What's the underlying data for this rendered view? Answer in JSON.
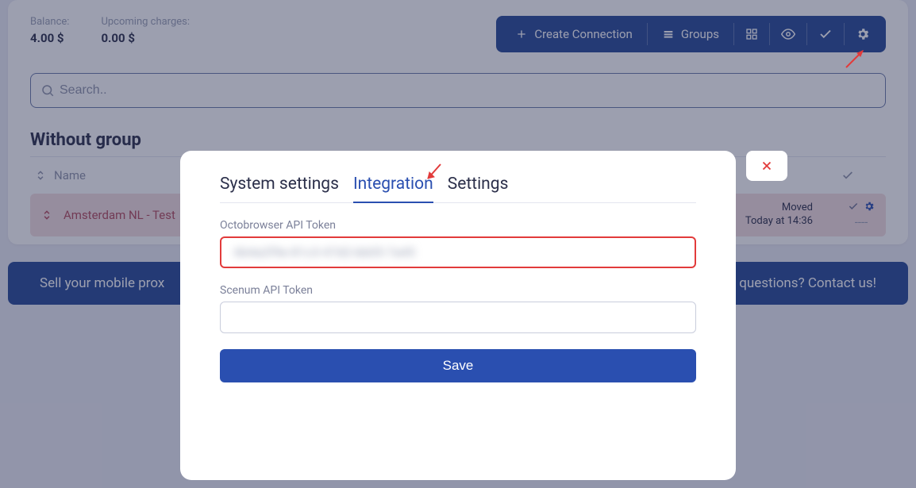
{
  "balances": {
    "balance_label": "Balance:",
    "balance_value": "4.00 $",
    "upcoming_label": "Upcoming charges:",
    "upcoming_value": "0.00 $"
  },
  "toolbar": {
    "create_label": "Create Connection",
    "groups_label": "Groups"
  },
  "search": {
    "placeholder": "Search.."
  },
  "group": {
    "title": "Without group",
    "name_header": "Name"
  },
  "row": {
    "name": "Amsterdam NL - Test",
    "status_line1": "Moved",
    "status_line2": "Today at 14:36",
    "empty": "----"
  },
  "banner": {
    "left": "Sell your mobile prox",
    "right": "Have questions? Contact us!"
  },
  "modal": {
    "tabs": {
      "system": "System settings",
      "integration": "Integration",
      "settings": "Settings"
    },
    "octo_label": "Octobrowser API Token",
    "octo_value": "6b4a2f9e-81c3-47d2-bb05-7a45",
    "scenum_label": "Scenum API Token",
    "scenum_value": "",
    "save": "Save"
  }
}
